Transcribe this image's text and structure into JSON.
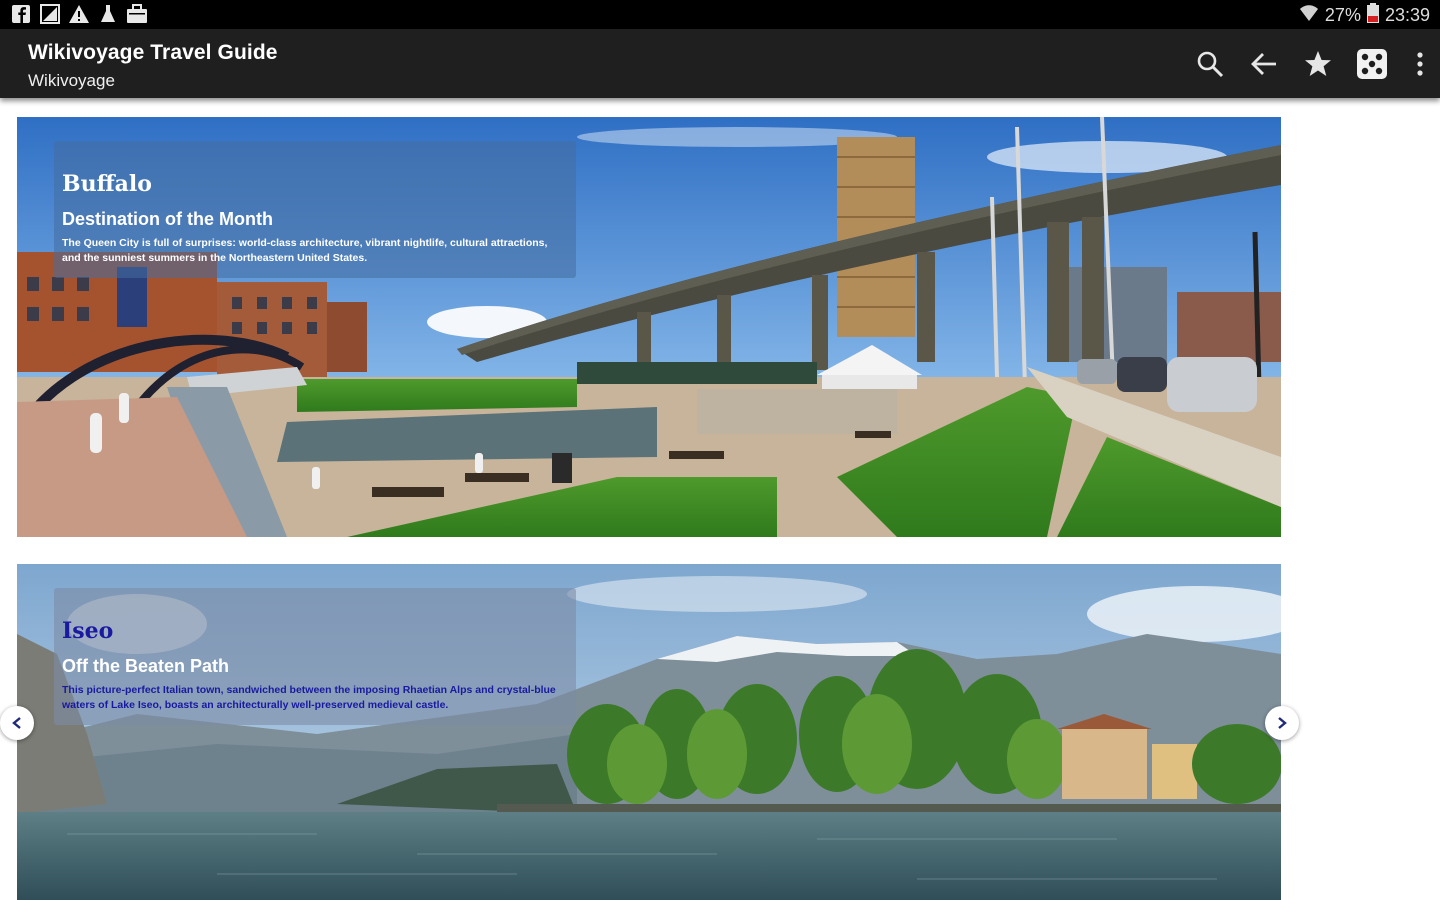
{
  "status_bar": {
    "battery": "27%",
    "time": "23:39",
    "icons": [
      "facebook-icon",
      "signal-edit-icon",
      "warning-icon",
      "flask-icon",
      "briefcase-icon",
      "wifi-icon",
      "battery-icon"
    ]
  },
  "app_bar": {
    "title": "Wikivoyage Travel Guide",
    "subtitle": "Wikivoyage",
    "actions": [
      "search-icon",
      "back-arrow-icon",
      "star-icon",
      "dice-icon",
      "overflow-menu-icon"
    ]
  },
  "cards": [
    {
      "title": "Buffalo",
      "subtitle": "Destination of the Month",
      "description": "The Queen City is full of surprises: world-class architecture, vibrant nightlife, cultural attractions, and the sunniest summers in the Northeastern United States.",
      "title_color": "#ffffff",
      "text_color": "#ffffff"
    },
    {
      "title": "Iseo",
      "subtitle": "Off the Beaten Path",
      "description": "This picture-perfect Italian town, sandwiched between the imposing Rhaetian Alps and crystal-blue waters of Lake Iseo, boasts an architecturally well-preserved medieval castle.",
      "title_color": "#1a1aa0",
      "text_color": "#1a1aa0"
    }
  ],
  "carousel": {
    "prev_icon": "chevron-left-icon",
    "next_icon": "chevron-right-icon"
  },
  "colors": {
    "status_bar": "#000000",
    "app_bar": "#1f1f1f",
    "background": "#ffffff"
  }
}
